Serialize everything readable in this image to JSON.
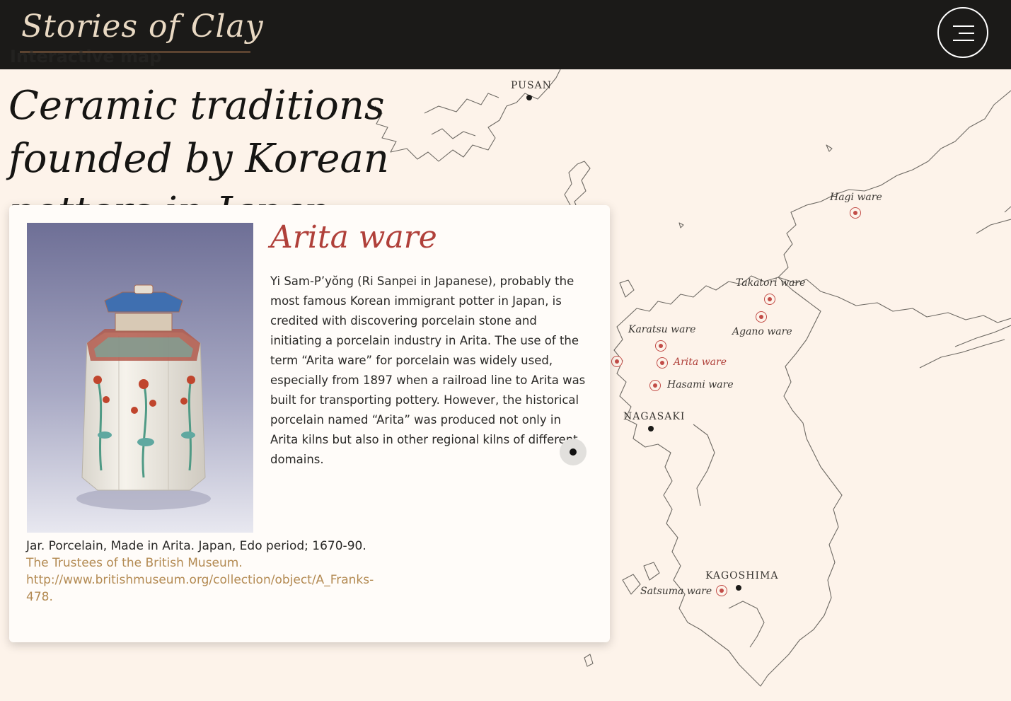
{
  "header": {
    "logo": "Stories of Clay",
    "kicker": "Interactive map",
    "menu_icon": "hamburger-icon"
  },
  "page": {
    "title": "Ceramic traditions founded by Korean potters in Japan"
  },
  "card": {
    "title": "Arita ware",
    "body": "Yi Sam-P’yŏng (Ri Sanpei in Japanese), probably the most famous Korean immigrant potter in Japan, is credited with discovering porcelain stone and initiating a porcelain industry in Arita. The use of the term “Arita ware” for porcelain was widely used, especially from 1897 when a railroad line to Arita was built for transporting pottery. However, the historical porcelain named “Arita” was produced not only in Arita kilns but also in other regional kilns of different domains.",
    "caption": "Jar. Porcelain, Made in Arita. Japan, Edo period; 1670-90.",
    "credit": "The Trustees of the British Museum.",
    "url": "http://www.britishmuseum.org/collection/object/A_Franks-478.",
    "audio_icon": "audio-dot-icon"
  },
  "map": {
    "cities": [
      "PUSAN",
      "NAGASAKI",
      "KAGOSHIMA"
    ],
    "wares": [
      "Hagi ware",
      "Takatori ware",
      "Agano ware",
      "Karatsu ware",
      "Arita ware",
      "Hasami ware",
      "Satsuma ware"
    ],
    "active_ware": "Arita ware",
    "colors": {
      "marker": "#c24c47",
      "active_label": "#b0403a",
      "background": "#fdf3ea",
      "coastline": "#6e6a64"
    }
  }
}
